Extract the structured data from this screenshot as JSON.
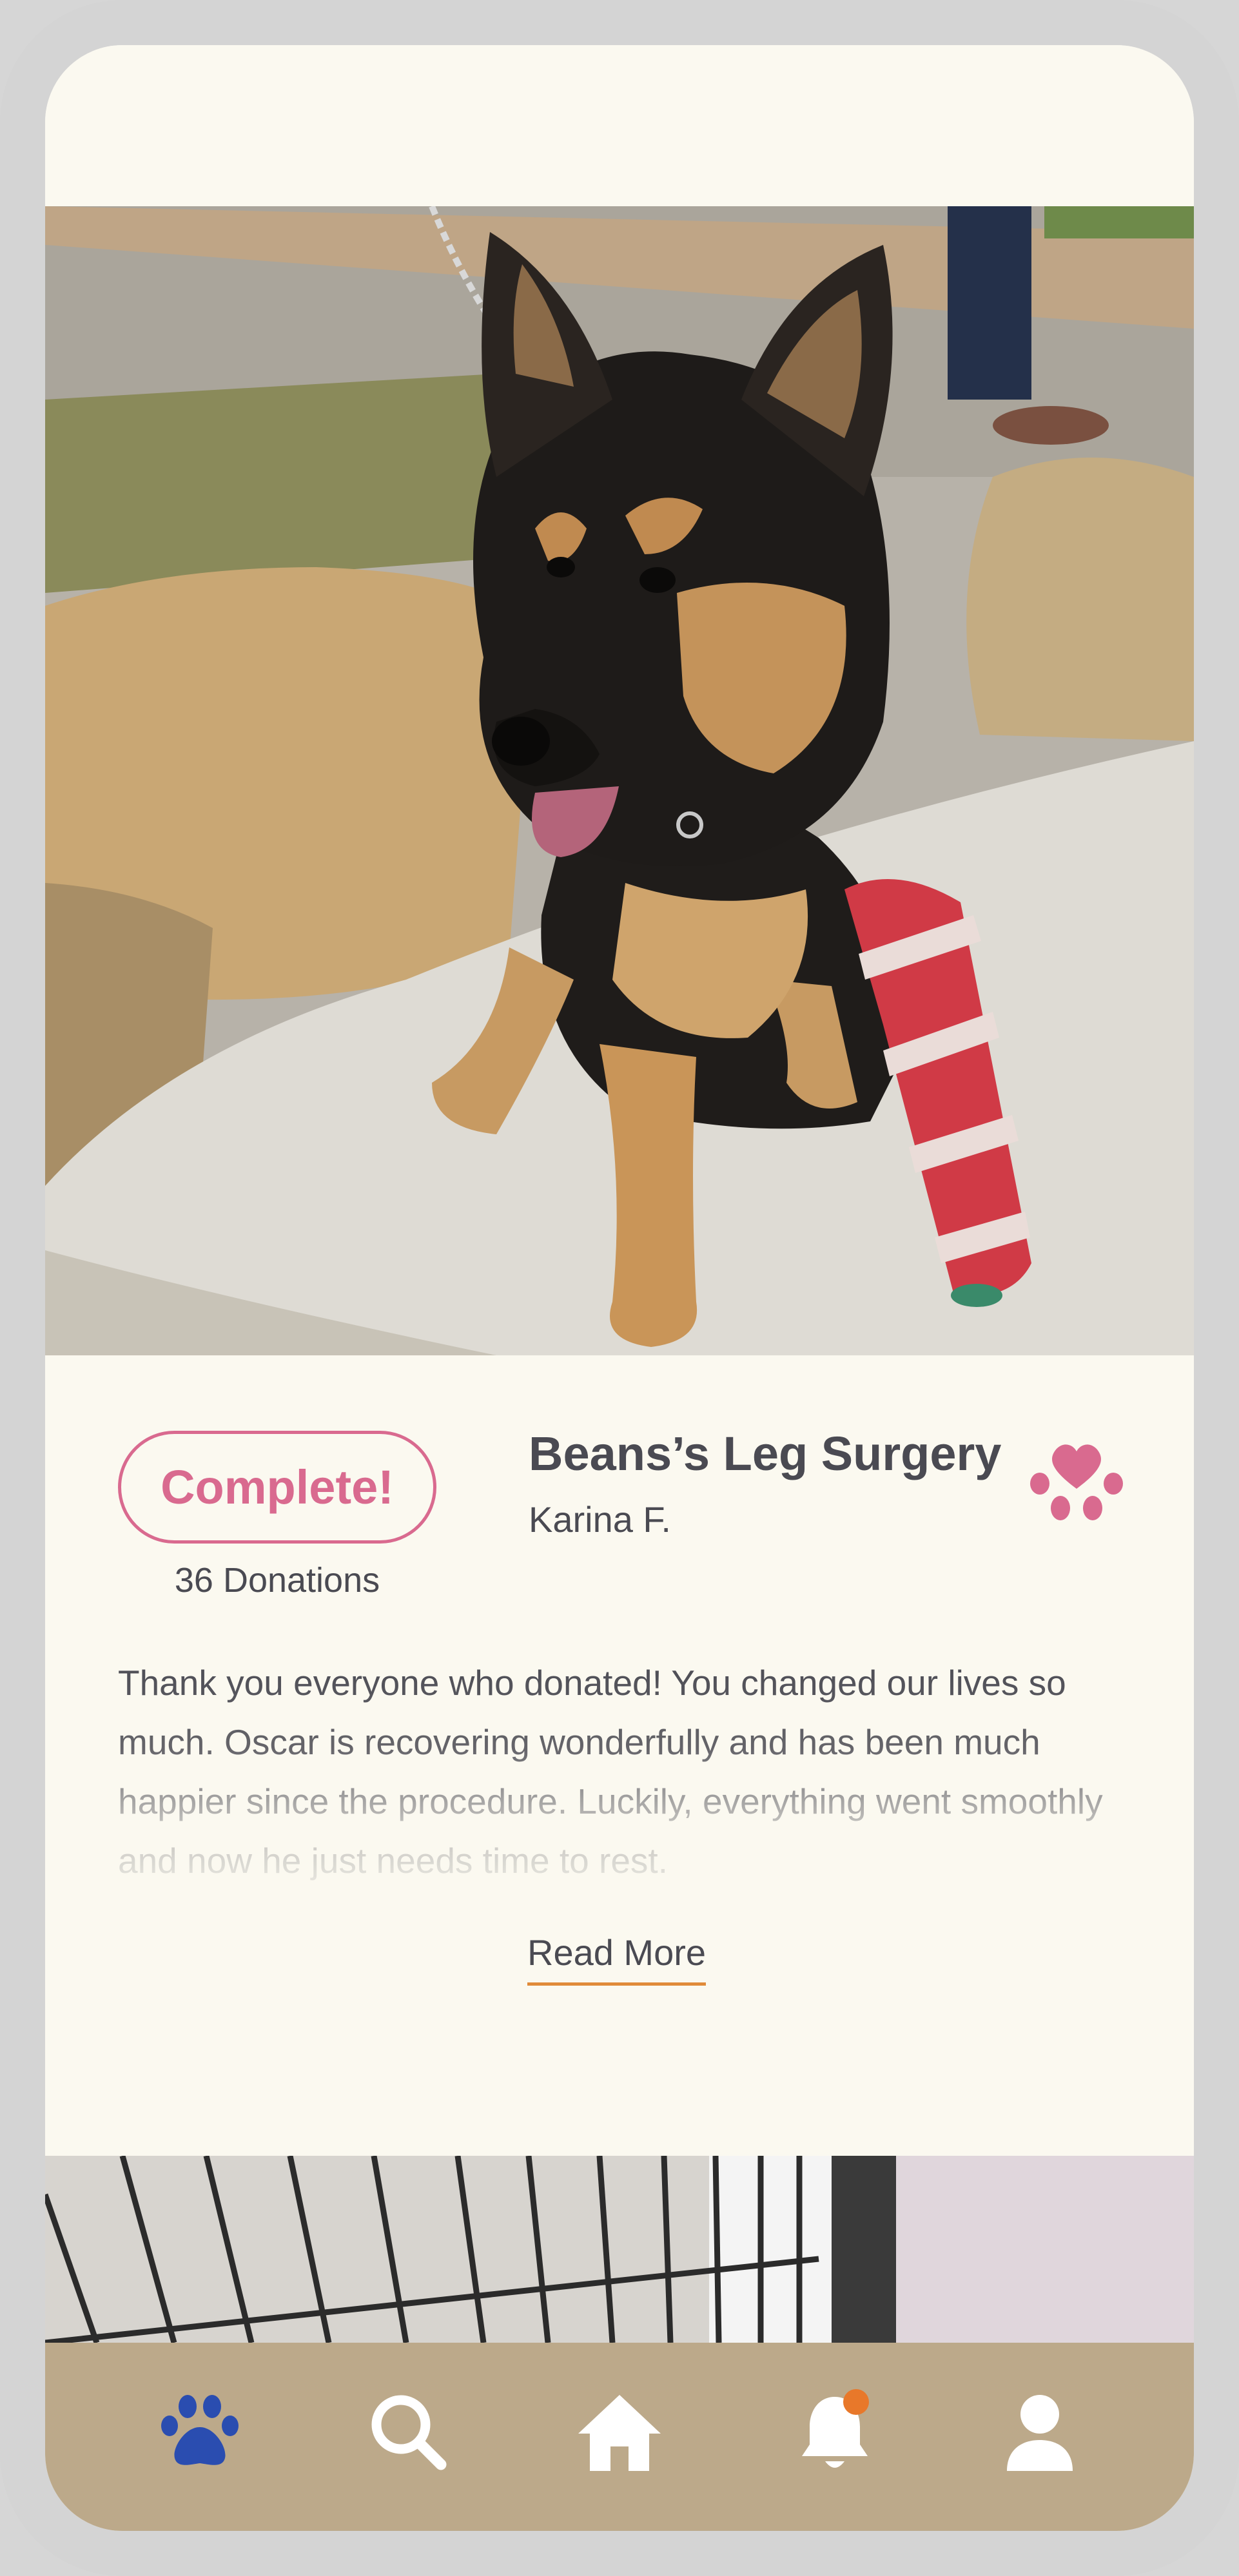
{
  "campaign": {
    "status_label": "Complete!",
    "donations_label": "36 Donations",
    "title": "Beans’s Leg Surgery",
    "author": "Karina F.",
    "description": "Thank you everyone who donated! You changed our lives so much. Oscar is recovering wonderfully and has been much happier since the procedure. Luckily, everything went smoothly and now he just needs time to rest.",
    "read_more_label": "Read More",
    "favorite_icon": "paw-heart-icon"
  },
  "nav": {
    "items": [
      {
        "icon": "paw-icon",
        "active": true
      },
      {
        "icon": "search-icon",
        "active": false
      },
      {
        "icon": "home-icon",
        "active": false
      },
      {
        "icon": "bell-icon",
        "active": false,
        "has_notification": true
      },
      {
        "icon": "user-icon",
        "active": false
      }
    ]
  },
  "colors": {
    "accent_pink": "#d96a8f",
    "underline_orange": "#e08b3a",
    "nav_bg": "#bca98a",
    "nav_active": "#2a4db0",
    "notification_dot": "#e8782a",
    "background": "#fbf9f0",
    "text": "#4a4a52"
  }
}
